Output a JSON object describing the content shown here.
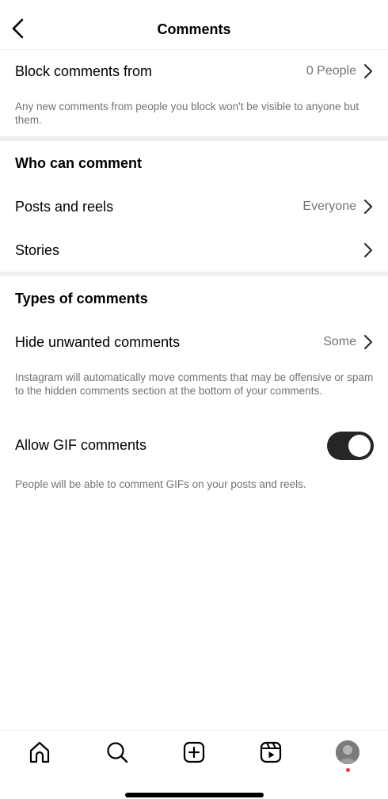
{
  "header": {
    "title": "Comments",
    "back_icon": "chevron-left-icon"
  },
  "block": {
    "label": "Block comments from",
    "value": "0 People",
    "note": "Any new comments from people you block won't be visible to anyone but them."
  },
  "who_can_comment": {
    "title": "Who can comment",
    "posts_label": "Posts and reels",
    "posts_value": "Everyone",
    "stories_label": "Stories"
  },
  "types": {
    "title": "Types of comments",
    "hide_label": "Hide unwanted comments",
    "hide_value": "Some",
    "hide_note": "Instagram will automatically move comments that may be offensive or spam to the hidden comments section at the bottom of your comments.",
    "gif_label": "Allow GIF comments",
    "gif_enabled": true,
    "gif_note": "People will be able to comment GIFs on your posts and reels."
  },
  "tabbar": {
    "icons": [
      "home-icon",
      "search-icon",
      "create-icon",
      "reels-icon",
      "profile-avatar"
    ]
  },
  "colors": {
    "secondary_text": "#737373",
    "toggle_on": "#262626",
    "notification_dot": "#ff3040"
  }
}
